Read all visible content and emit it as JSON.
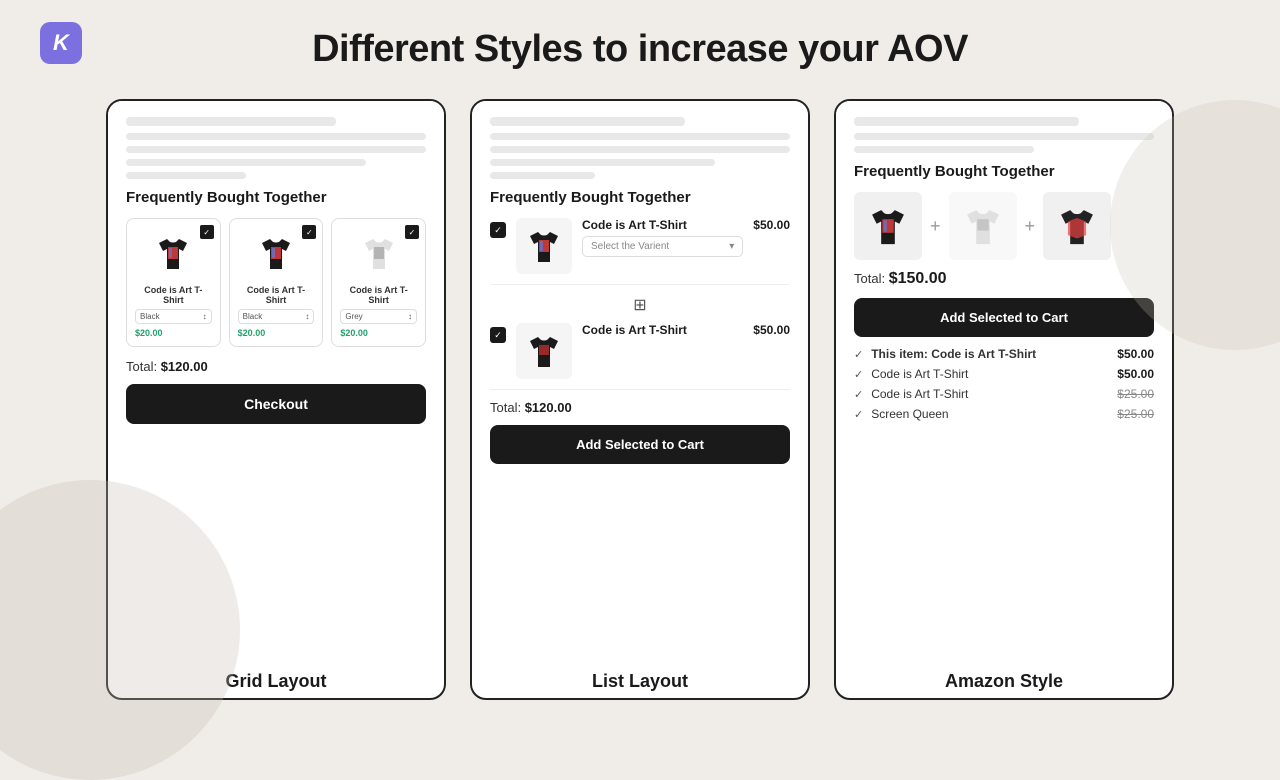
{
  "logo": {
    "letter": "K"
  },
  "header": {
    "title": "Different Styles to increase your AOV"
  },
  "cards": [
    {
      "id": "grid",
      "section_title": "Frequently Bought Together",
      "items": [
        {
          "name": "Code is Art T-Shirt",
          "color": "Black",
          "price": "$20.00",
          "checked": true
        },
        {
          "name": "Code is Art T-Shirt",
          "color": "Black",
          "price": "$20.00",
          "checked": true
        },
        {
          "name": "Code is Art T-Shirt",
          "color": "Grey",
          "price": "$20.00",
          "checked": true
        }
      ],
      "total_label": "Total:",
      "total_amount": "$120.00",
      "button_label": "Checkout",
      "card_label": "Grid Layout"
    },
    {
      "id": "list",
      "section_title": "Frequently Bought Together",
      "items": [
        {
          "name": "Code is Art T-Shirt",
          "price": "$50.00",
          "variant_placeholder": "Select the Varient",
          "checked": true
        },
        {
          "name": "Code is Art T-Shirt",
          "price": "$50.00",
          "checked": true
        }
      ],
      "total_label": "Total:",
      "total_amount": "$120.00",
      "button_label": "Add Selected  to Cart",
      "card_label": "List Layout"
    },
    {
      "id": "amazon",
      "section_title": "Frequently Bought Together",
      "total_label": "Total:",
      "total_amount": "$150.00",
      "button_label": "Add Selected to Cart",
      "items": [
        {
          "name": "This item: Code is Art T-Shirt",
          "price": "$50.00",
          "bold": true
        },
        {
          "name": "Code is Art T-Shirt",
          "price": "$50.00",
          "bold": false
        },
        {
          "name": "Code is Art T-Shirt",
          "price": "$25.00",
          "strikethrough": true,
          "bold": false
        },
        {
          "name": "Screen Queen",
          "price": "$25.00",
          "strikethrough": true,
          "bold": false
        }
      ],
      "card_label": "Amazon Style"
    }
  ]
}
